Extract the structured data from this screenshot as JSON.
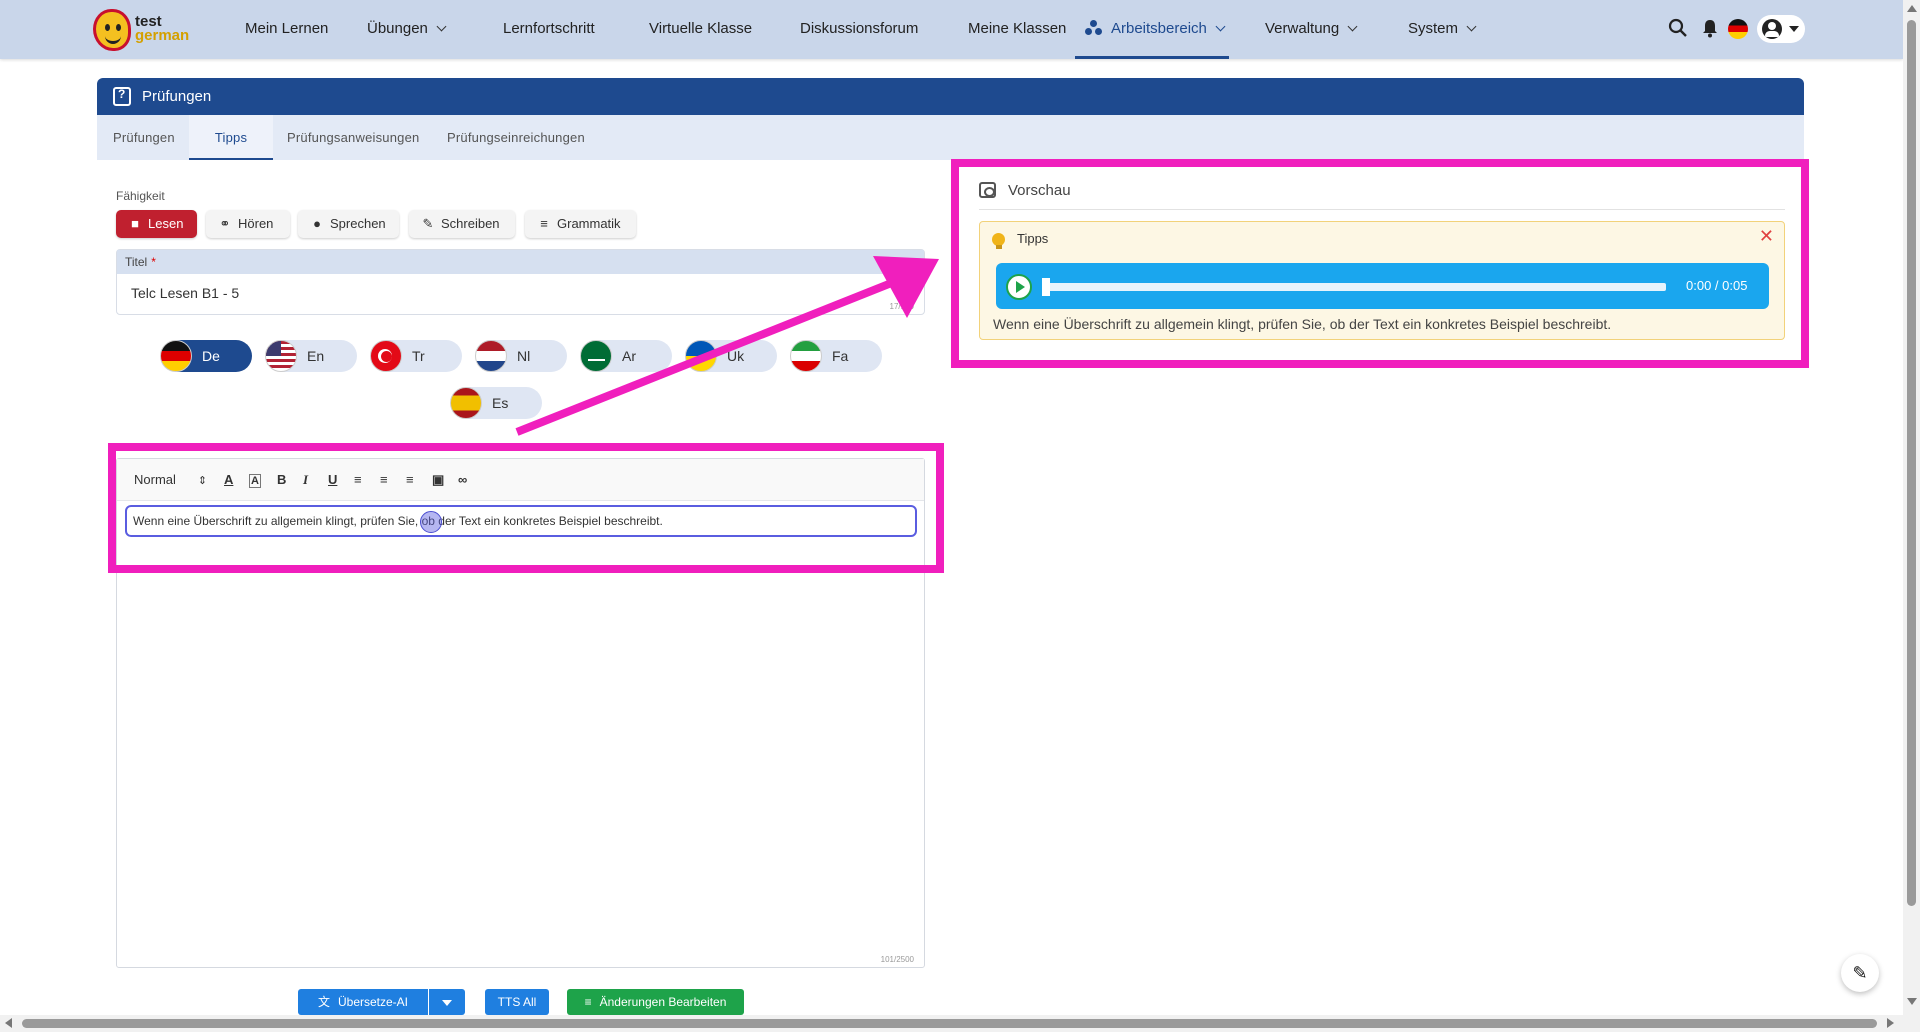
{
  "brand": {
    "line1": "test",
    "line2": "german"
  },
  "nav": {
    "items": [
      {
        "label": "Mein Lernen"
      },
      {
        "label": "Übungen"
      },
      {
        "label": "Lernfortschritt"
      },
      {
        "label": "Virtuelle Klasse"
      },
      {
        "label": "Diskussionsforum"
      },
      {
        "label": "Meine Klassen"
      },
      {
        "label": "Arbeitsbereich"
      },
      {
        "label": "Verwaltung"
      },
      {
        "label": "System"
      }
    ],
    "icons": [
      "search-icon",
      "bell-icon",
      "flag-de-icon",
      "user-icon"
    ]
  },
  "card": {
    "title": "Prüfungen"
  },
  "subtabs": [
    "Prüfungen",
    "Tipps",
    "Prüfungsanweisungen",
    "Prüfungseinreichungen"
  ],
  "form": {
    "skill_label": "Fähigkeit",
    "skills": [
      "Lesen",
      "Hören",
      "Sprechen",
      "Schreiben",
      "Grammatik"
    ],
    "title_label": "Titel",
    "required_mark": "*",
    "title_value": "Telc Lesen B1 - 5",
    "title_count": "17/100",
    "languages": [
      "De",
      "En",
      "Tr",
      "Nl",
      "Ar",
      "Uk",
      "Fa",
      "Es"
    ],
    "active_language": "De"
  },
  "editor": {
    "format": "Normal",
    "content": "Wenn eine Überschrift zu allgemein klingt, prüfen Sie, ob der Text ein konkretes Beispiel beschreibt.",
    "count": "101/2500"
  },
  "buttons": {
    "translate": "Übersetze-AI",
    "tts": "TTS All",
    "edit": "Änderungen Bearbeiten"
  },
  "preview": {
    "title": "Vorschau",
    "tip_title": "Tipps",
    "audio_time": "0:00 / 0:05",
    "text": "Wenn eine Überschrift zu allgemein klingt, prüfen Sie, ob der Text ein konkretes Beispiel beschreibt."
  },
  "colors": {
    "primary": "#1e4a8f",
    "nav_bg": "#c9d6ea",
    "active_skill": "#c0202f",
    "highlight": "#f01fbd",
    "audio": "#1aa6ee",
    "tip_bg": "#fdf7e4"
  }
}
